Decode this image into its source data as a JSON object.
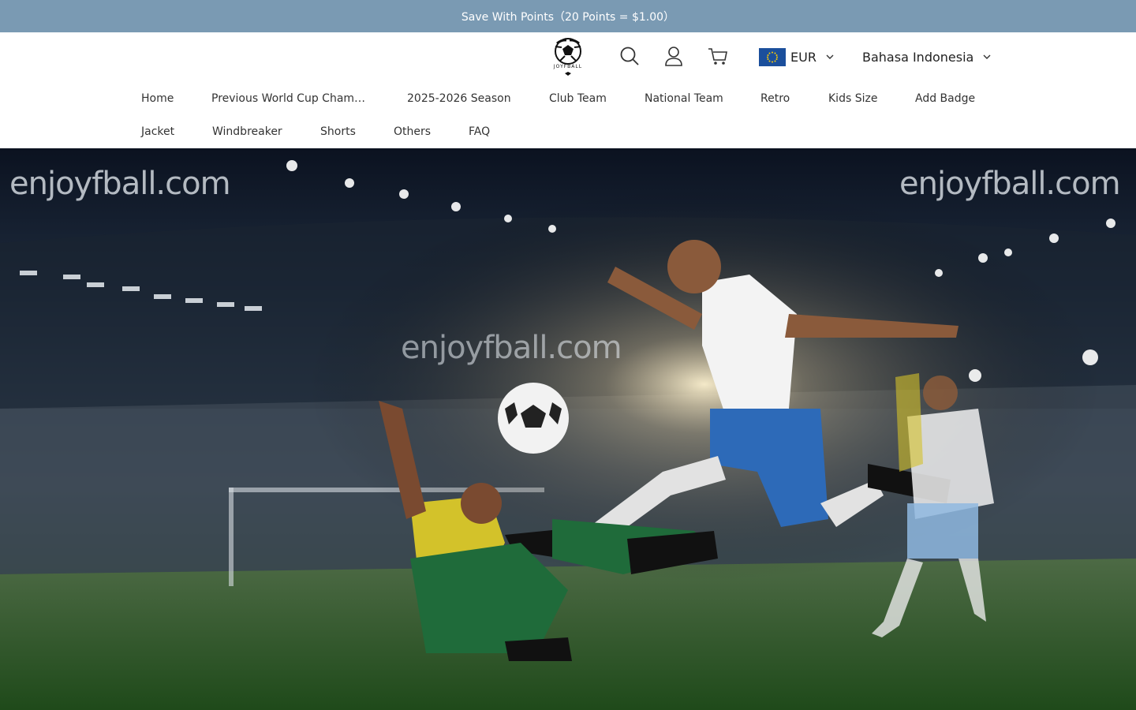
{
  "announcement": {
    "text": "Save With Points（20 Points = $1.00）"
  },
  "header": {
    "logo_text": "JOYFBALL",
    "icons": [
      "search-icon",
      "account-icon",
      "cart-icon"
    ],
    "currency": {
      "code": "EUR",
      "flag": "eu-flag-icon"
    },
    "language": {
      "label": "Bahasa Indonesia"
    }
  },
  "nav": {
    "row1": [
      "Home",
      "Previous World Cup Cham…",
      "2025-2026 Season",
      "Club Team",
      "National Team",
      "Retro",
      "Kids Size",
      "Add Badge"
    ],
    "row2": [
      "Jacket",
      "Windbreaker",
      "Shorts",
      "Others",
      "FAQ"
    ]
  },
  "hero": {
    "watermarks": [
      "enjoyfball.com",
      "enjoyfball.com",
      "enjoyfball.com"
    ]
  },
  "colors": {
    "announcement_bg": "#7a9ab3",
    "text": "#222222"
  }
}
